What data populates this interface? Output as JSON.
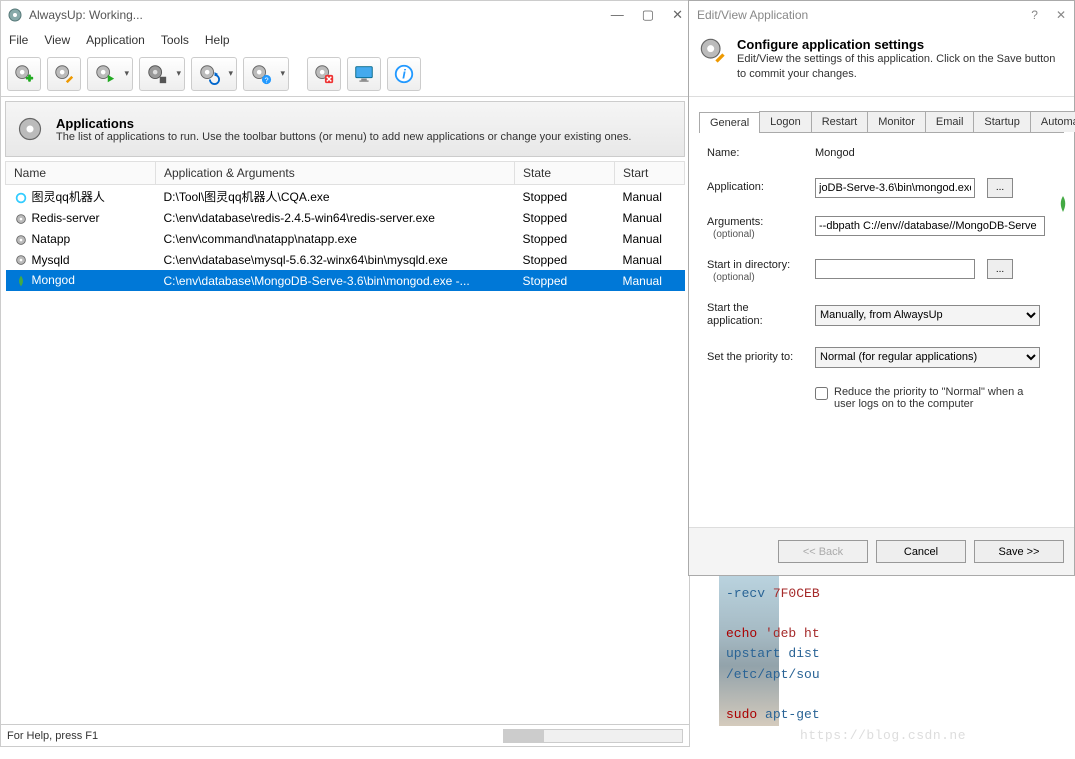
{
  "main": {
    "title": "AlwaysUp: Working...",
    "menu": {
      "file": "File",
      "view": "View",
      "application": "Application",
      "tools": "Tools",
      "help": "Help"
    },
    "header": {
      "title": "Applications",
      "desc": "The list of applications to run. Use the toolbar buttons (or menu) to add new applications or change your existing ones."
    },
    "columns": {
      "name": "Name",
      "app": "Application & Arguments",
      "state": "State",
      "start": "Start"
    },
    "rows": [
      {
        "name": "图灵qq机器人",
        "app": "D:\\Tool\\图灵qq机器人\\CQA.exe",
        "state": "Stopped",
        "start": "Manual"
      },
      {
        "name": "Redis-server",
        "app": "C:\\env\\database\\redis-2.4.5-win64\\redis-server.exe",
        "state": "Stopped",
        "start": "Manual"
      },
      {
        "name": "Natapp",
        "app": "C:\\env\\command\\natapp\\natapp.exe",
        "state": "Stopped",
        "start": "Manual"
      },
      {
        "name": "Mysqld",
        "app": "C:\\env\\database\\mysql-5.6.32-winx64\\bin\\mysqld.exe",
        "state": "Stopped",
        "start": "Manual"
      },
      {
        "name": "Mongod",
        "app": "C:\\env\\database\\MongoDB-Serve-3.6\\bin\\mongod.exe -...",
        "state": "Stopped",
        "start": "Manual"
      }
    ],
    "status": "For Help, press F1"
  },
  "dialog": {
    "title": "Edit/View Application",
    "head_title": "Configure application settings",
    "head_desc": "Edit/View the settings of this application. Click on the Save button to commit your changes.",
    "tabs": [
      "General",
      "Logon",
      "Restart",
      "Monitor",
      "Email",
      "Startup",
      "Automate"
    ],
    "form": {
      "name_label": "Name:",
      "name_value": "Mongod",
      "app_label": "Application:",
      "app_value": "joDB-Serve-3.6\\bin\\mongod.exe",
      "args_label": "Arguments:",
      "args_sub": "(optional)",
      "args_value": "--dbpath C://env//database//MongoDB-Serve",
      "startin_label": "Start in directory:",
      "startin_sub": "(optional)",
      "startin_value": "",
      "starttype_label": "Start the application:",
      "starttype_value": "Manually, from AlwaysUp",
      "priority_label": "Set the priority to:",
      "priority_value": "Normal (for regular applications)",
      "reduce_label": "Reduce the priority to \"Normal\" when a user logs on to the computer"
    },
    "buttons": {
      "back": "<< Back",
      "cancel": "Cancel",
      "save": "Save >>"
    }
  },
  "bg": {
    "l1a": "-recv ",
    "l1b": "7F0CEB",
    "l2a": "echo ",
    "l2b": "'deb ht",
    "l3": "upstart dist",
    "l4": "/etc/apt/sou",
    "l5a": "sudo ",
    "l5b": "apt-get"
  },
  "watermark": "https://blog.csdn.ne"
}
